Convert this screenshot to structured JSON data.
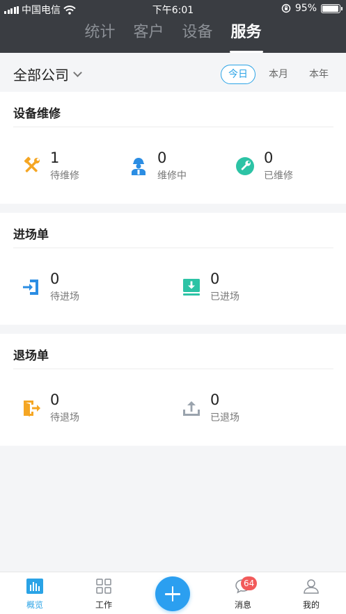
{
  "status_bar": {
    "carrier": "中国电信",
    "time": "下午6:01",
    "battery": "95%",
    "battery_level": 0.95
  },
  "top_tabs": [
    {
      "label": "统计"
    },
    {
      "label": "客户"
    },
    {
      "label": "设备"
    },
    {
      "label": "服务",
      "active": true
    }
  ],
  "filter": {
    "company": "全部公司",
    "periods": [
      {
        "label": "今日",
        "active": true
      },
      {
        "label": "本月"
      },
      {
        "label": "本年"
      }
    ]
  },
  "sections": {
    "repair": {
      "title": "设备维修",
      "stats": [
        {
          "value": "1",
          "label": "待维修",
          "icon": "hammer-wrench-icon",
          "color": "#f5a623"
        },
        {
          "value": "0",
          "label": "维修中",
          "icon": "mechanic-icon",
          "color": "#2b8de3"
        },
        {
          "value": "0",
          "label": "已维修",
          "icon": "wrench-circle-icon",
          "color": "#2cc3a5"
        }
      ]
    },
    "entry": {
      "title": "进场单",
      "stats": [
        {
          "value": "0",
          "label": "待进场",
          "icon": "enter-door-icon",
          "color": "#2b8de3"
        },
        {
          "value": "0",
          "label": "已进场",
          "icon": "download-box-icon",
          "color": "#2cc3a5"
        }
      ]
    },
    "exit": {
      "title": "退场单",
      "stats": [
        {
          "value": "0",
          "label": "待退场",
          "icon": "exit-door-icon",
          "color": "#f5a623"
        },
        {
          "value": "0",
          "label": "已退场",
          "icon": "upload-icon",
          "color": "#9aa3ad"
        }
      ]
    }
  },
  "bottom_nav": {
    "items": [
      {
        "label": "概览",
        "icon": "chart-icon",
        "active": true
      },
      {
        "label": "工作",
        "icon": "grid-icon"
      },
      {
        "label": "消息",
        "icon": "message-icon",
        "badge": "64"
      },
      {
        "label": "我的",
        "icon": "user-icon"
      }
    ],
    "accent": "#2aa3e6"
  }
}
